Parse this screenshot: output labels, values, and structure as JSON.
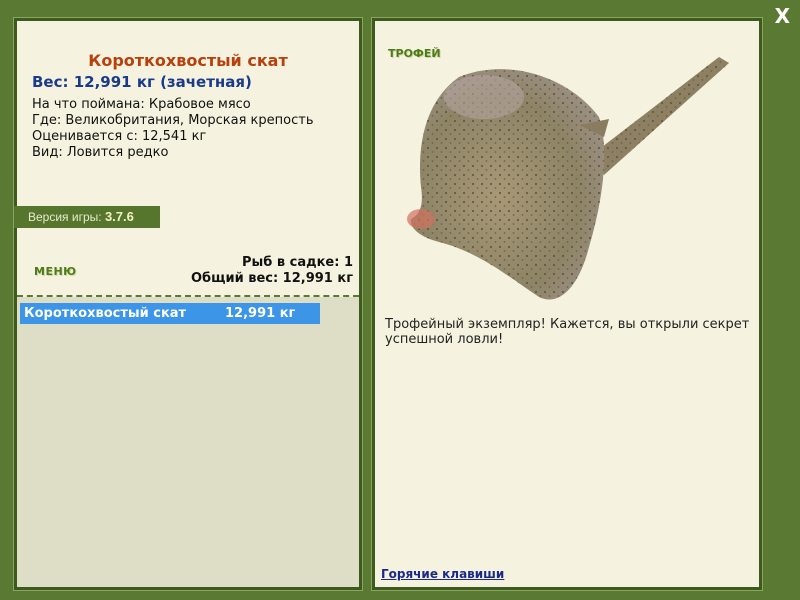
{
  "window": {
    "close_label": "X"
  },
  "fish": {
    "title": "Короткохвостый скат",
    "weight": "Вес: 12,991 кг (зачетная)",
    "bait": "На что поймана: Крабовое мясо",
    "location": "Где: Великобритания, Морская крепость",
    "rated_from": "Оценивается с: 12,541 кг",
    "rarity": "Вид: Ловится редко"
  },
  "version": {
    "label": "Версия игры:",
    "value": "3.7.6"
  },
  "menu_label": "МЕНЮ",
  "stats": {
    "fish_count": "Рыб в садке: 1",
    "total_weight": "Общий вес: 12,991 кг"
  },
  "catch_list": [
    {
      "name": "Короткохвостый скат",
      "weight": "12,991 кг"
    }
  ],
  "trophy": {
    "label": "ТРОФЕЙ",
    "description": "Трофейный экземпляр! Кажется, вы открыли секрет успешной ловли!"
  },
  "hotkeys_label": "Горячие клавиши",
  "colors": {
    "background": "#5a7a34",
    "panel": "#f5f3df",
    "title": "#b8400c",
    "weight": "#1b3a8a",
    "selection": "#3c95e6"
  },
  "icons": {
    "close": "close-icon",
    "fish": "ray-fish-image"
  }
}
